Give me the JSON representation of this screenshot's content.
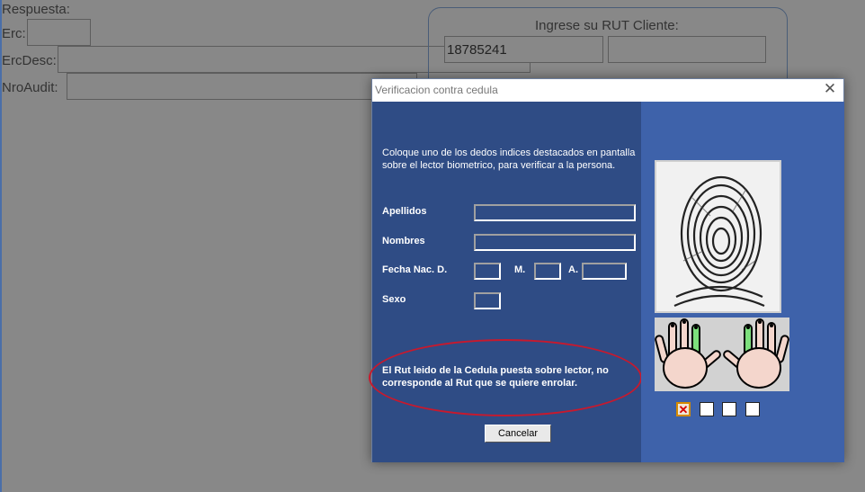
{
  "background": {
    "respuesta_label": "Respuesta:",
    "erc_label": "Erc:",
    "ercdesc_label": "ErcDesc:",
    "nroaudit_label": "NroAudit:",
    "rut_title": "Ingrese su RUT Cliente:",
    "rut_value": "18785241",
    "rut_value2": ""
  },
  "dialog": {
    "title": "Verificacion contra cedula",
    "close_glyph": "✕",
    "instruction": "Coloque uno de los dedos indices destacados en pantalla sobre el lector biometrico,  para verificar a la persona.",
    "fields": {
      "apellidos_label": "Apellidos",
      "nombres_label": "Nombres",
      "fecha_label": "Fecha Nac. D.",
      "mes_label": "M.",
      "anio_label": "A.",
      "sexo_label": "Sexo",
      "apellidos_value": "",
      "nombres_value": "",
      "dia_value": "",
      "mes_value": "",
      "anio_value": "",
      "sexo_value": ""
    },
    "error_message": "El Rut leido de la Cedula puesta sobre lector, no corresponde al Rut que se quiere enrolar.",
    "cancel_label": "Cancelar",
    "checkbox_states": [
      "failed",
      "empty",
      "empty",
      "empty"
    ],
    "failed_glyph": "✕"
  },
  "colors": {
    "left_pane": "#2f4c85",
    "right_pane": "#3e62aa",
    "highlight_ellipse": "#c8192d",
    "highlighted_finger": "#7de07d"
  }
}
